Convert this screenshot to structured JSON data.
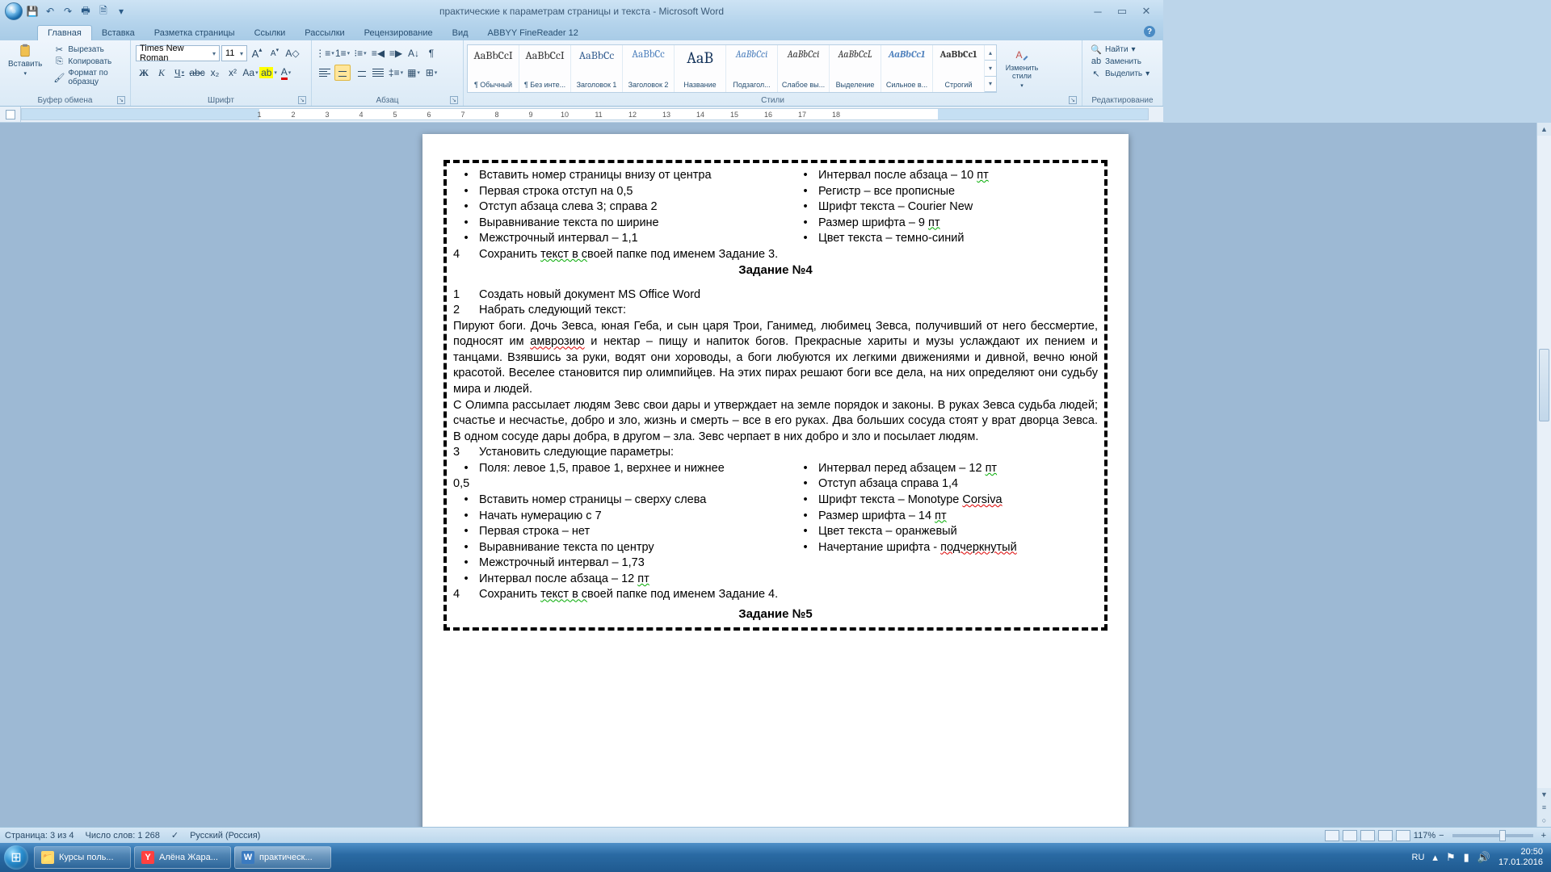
{
  "window": {
    "title": "практические к параметрам страницы и текста - Microsoft Word"
  },
  "qat": {
    "save": "💾",
    "undo": "↶",
    "redo": "↷",
    "print": "🖶",
    "preview": "🗎",
    "more": "▾"
  },
  "tabs": [
    "Главная",
    "Вставка",
    "Разметка страницы",
    "Ссылки",
    "Рассылки",
    "Рецензирование",
    "Вид",
    "ABBYY FineReader 12"
  ],
  "ribbon": {
    "clipboard": {
      "label": "Буфер обмена",
      "paste": "Вставить",
      "cut": "Вырезать",
      "copy": "Копировать",
      "format": "Формат по образцу"
    },
    "font": {
      "label": "Шрифт",
      "name": "Times New Roman",
      "size": "11"
    },
    "paragraph": {
      "label": "Абзац"
    },
    "styles": {
      "label": "Стили",
      "items": [
        {
          "prev": "AaBbCcI",
          "cls": "",
          "name": "¶ Обычный"
        },
        {
          "prev": "AaBbCcI",
          "cls": "",
          "name": "¶ Без инте..."
        },
        {
          "prev": "AaBbCc",
          "cls": "h1",
          "name": "Заголовок 1"
        },
        {
          "prev": "AaBbCc",
          "cls": "h2",
          "name": "Заголовок 2"
        },
        {
          "prev": "AaB",
          "cls": "title",
          "name": "Название"
        },
        {
          "prev": "AaBbCci",
          "cls": "sub",
          "name": "Подзагол..."
        },
        {
          "prev": "AaBbCci",
          "cls": "emph",
          "name": "Слабое вы..."
        },
        {
          "prev": "AaBbCcL",
          "cls": "emph",
          "name": "Выделение"
        },
        {
          "prev": "AaBbCc1",
          "cls": "int",
          "name": "Сильное в..."
        },
        {
          "prev": "AaBbCc1",
          "cls": "strong",
          "name": "Строгий"
        }
      ],
      "change": "Изменить стили"
    },
    "editing": {
      "label": "Редактирование",
      "find": "Найти",
      "replace": "Заменить",
      "select": "Выделить"
    }
  },
  "ruler": {
    "marks": [
      1,
      2,
      3,
      4,
      5,
      6,
      7,
      8,
      9,
      10,
      11,
      12,
      13,
      14,
      15,
      16,
      17,
      18
    ]
  },
  "doc": {
    "leftBullets1": [
      "Вставить номер страницы внизу от центра",
      "Первая строка отступ на 0,5",
      "Отступ абзаца слева  3; справа  2",
      "Выравнивание текста по ширине",
      "Межстрочный интервал – 1,1"
    ],
    "rightBullets1": [
      {
        "t": "Интервал после абзаца – 10 ",
        "u": "пт"
      },
      {
        "t": "Регистр – все прописные",
        "u": ""
      },
      {
        "t": "Шрифт текста – Courier New",
        "u": ""
      },
      {
        "t": "Размер шрифта – 9 ",
        "u": "пт"
      },
      {
        "t": "Цвет текста – темно-синий",
        "u": ""
      }
    ],
    "save3_num": "4",
    "save3_a": "Сохранить ",
    "save3_b": "текст  в  с",
    "save3_c": "воей папке под именем Задание 3.",
    "heading4": "Задание №4",
    "t4_1_num": "1",
    "t4_1": "Создать новый документ MS Office Word",
    "t4_2_num": "2",
    "t4_2": "Набрать следующий текст:",
    "para1_a": "Пируют боги. Дочь Зевса, юная Геба, и сын царя Трои, Ганимед, любимец Зевса, получивший от него бессмертие, подносят им ",
    "para1_amb": "амврозию",
    "para1_b": " и нектар – пищу и напиток богов. Прекрасные хариты и музы услаждают их пением и танцами. Взявшись за руки, водят они хороводы, а боги любуются их легкими движениями и дивной, вечно юной красотой. Веселее становится пир олимпийцев. На этих пирах решают боги все дела, на них определяют они судьбу мира и людей.",
    "para2": "С Олимпа рассылает людям Зевс свои дары и утверждает на земле порядок и законы. В руках Зевса судьба людей; счастье и несчастье, добро и зло, жизнь и смерть – все в его руках. Два больших сосуда стоят у врат дворца Зевса. В одном сосуде дары добра, в другом – зла. Зевс черпает в них добро и зло и посылает людям.",
    "t4_3_num": "3",
    "t4_3": "Установить следующие параметры:",
    "leftBullets2a": "Поля: левое  1,5, правое  1, верхнее и нижнее  ",
    "leftBullets2a_ext": "0,5",
    "leftBullets2": [
      "Вставить номер страницы – сверху слева",
      "Начать нумерацию с 7",
      "Первая строка – нет",
      "Выравнивание текста по центру",
      "Межстрочный интервал – 1,73"
    ],
    "leftBullets2_last_a": "Интервал после абзаца – 12 ",
    "leftBullets2_last_b": "пт",
    "rightBullets2": [
      {
        "t": "Интервал перед абзацем – 12 ",
        "u": "пт"
      },
      {
        "t": "Отступ абзаца справа  1,4",
        "u": ""
      }
    ],
    "rb2_font_a": "Шрифт текста – Monotype ",
    "rb2_font_b": "Corsiva",
    "rb2_size_a": "Размер шрифта – 14 ",
    "rb2_size_b": "пт",
    "rb2_color": "Цвет текста – оранжевый",
    "rb2_style_a": "Начертание шрифта - ",
    "rb2_style_b": "подчеркнутый",
    "save4_num": "4",
    "save4_a": "Сохранить ",
    "save4_b": "текст  в  с",
    "save4_c": "воей папке под именем Задание 4.",
    "heading5": "Задание №5"
  },
  "status": {
    "page": "Страница: 3 из 4",
    "words": "Число слов: 1 268",
    "lang": "Русский (Россия)",
    "zoom": "117%"
  },
  "taskbar": {
    "items": [
      {
        "icon": "📁",
        "label": "Курсы поль...",
        "active": false,
        "ico_bg": "#ffd76a"
      },
      {
        "icon": "Y",
        "label": "Алёна Жара...",
        "active": false,
        "ico_bg": "#ff4040",
        "ico_color": "#fff"
      },
      {
        "icon": "W",
        "label": "практическ...",
        "active": true,
        "ico_bg": "#3a7ac0",
        "ico_color": "#fff"
      }
    ],
    "lang": "RU",
    "time": "20:50",
    "date": "17.01.2016"
  }
}
